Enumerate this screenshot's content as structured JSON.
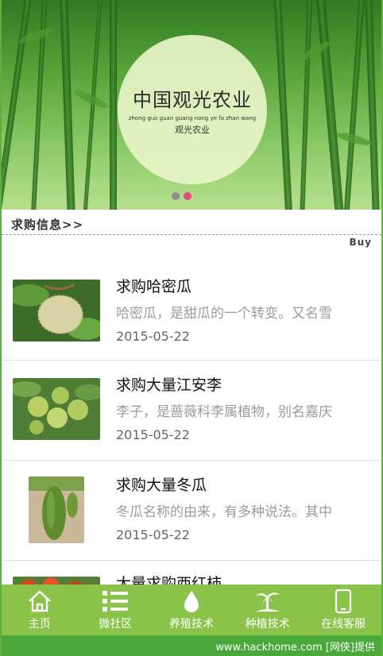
{
  "banner": {
    "title": "中国观光农业",
    "pinyin": "zhong guo guan guang nong ye fa zhan wang",
    "subtitle": "观光农业",
    "dot_colors": [
      "#8f8f8f",
      "#e8467c"
    ]
  },
  "section": {
    "title": "求购信息>>",
    "more_label": "Buy"
  },
  "items": [
    {
      "title": "求购哈密瓜",
      "desc": "哈密瓜，是甜瓜的一个转变。又名雪",
      "date": "2015-05-22"
    },
    {
      "title": "求购大量江安李",
      "desc": "李子，是蔷薇科李属植物，别名嘉庆",
      "date": "2015-05-22"
    },
    {
      "title": "求购大量冬瓜",
      "desc": "冬瓜名称的由来，有多种说法。其中",
      "date": "2015-05-22"
    },
    {
      "title": "大量求购西红柿",
      "desc": "",
      "date": ""
    }
  ],
  "nav": [
    {
      "label": "主页",
      "icon": "home-icon"
    },
    {
      "label": "微社区",
      "icon": "list-icon"
    },
    {
      "label": "养殖技术",
      "icon": "water-drop-icon"
    },
    {
      "label": "种植技术",
      "icon": "palm-tree-icon"
    },
    {
      "label": "在线客服",
      "icon": "phone-icon"
    }
  ],
  "footer": {
    "text": "www.hackhome.com [网侠]提供"
  },
  "colors": {
    "nav_bg": "#8bc34a",
    "footer_bg": "#4aa83a",
    "accent_dot": "#e8467c"
  }
}
